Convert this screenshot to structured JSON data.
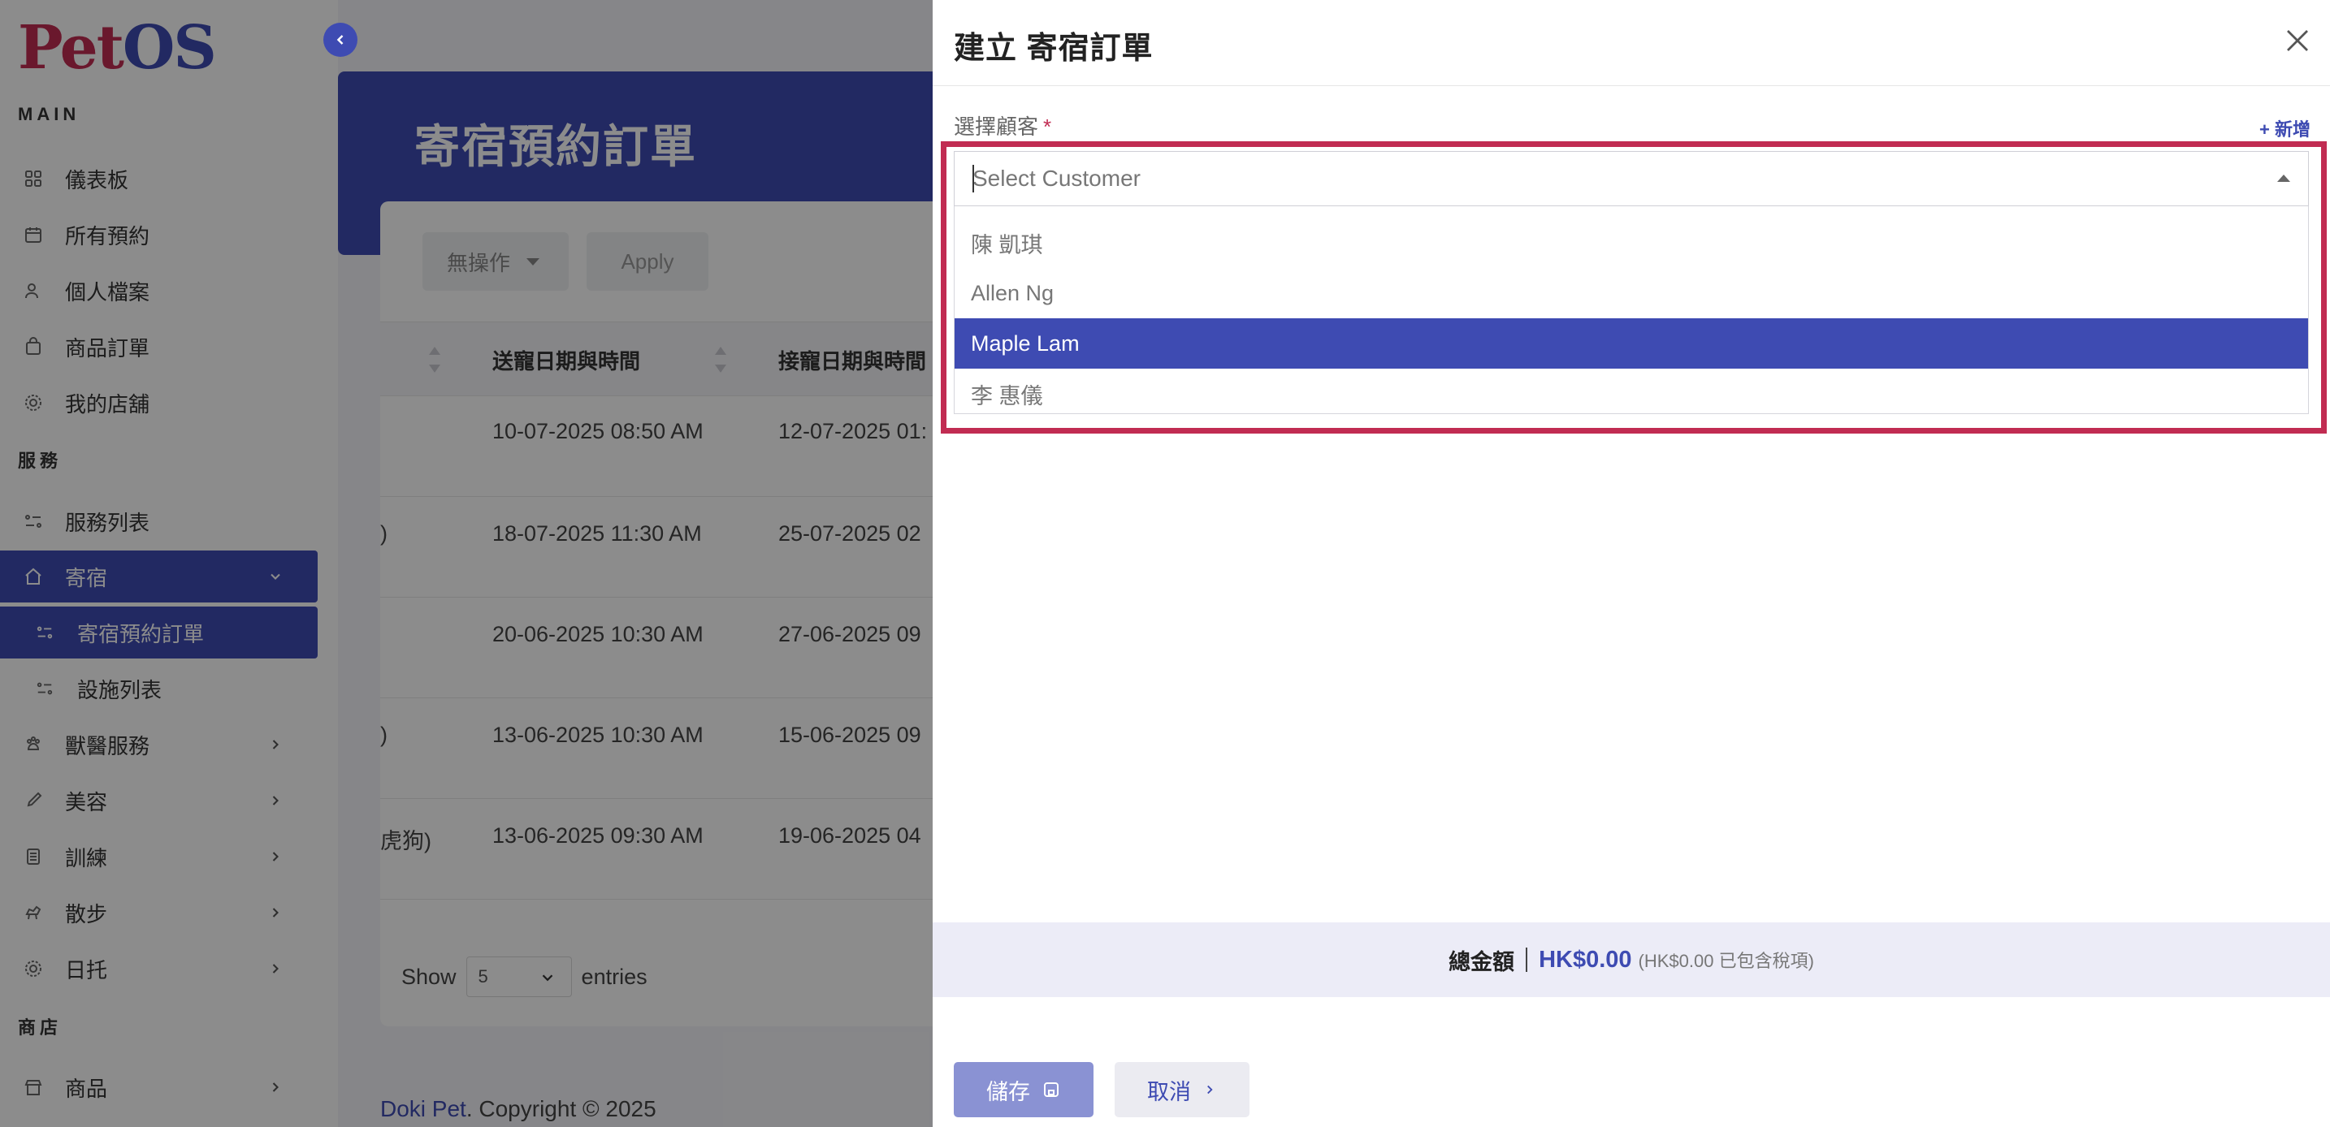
{
  "brand": {
    "logo_pet": "Pet",
    "logo_os": "OS"
  },
  "colors": {
    "primary": "#3e4bb2",
    "accent": "#c12c52",
    "overlay": "rgba(0,0,0,0.45)"
  },
  "sidebar": {
    "section_main": "MAIN",
    "section_services": "服務",
    "section_shop": "商店",
    "items": [
      {
        "label": "儀表板",
        "icon": "dashboard-grid-icon"
      },
      {
        "label": "所有預約",
        "icon": "calendar-icon"
      },
      {
        "label": "個人檔案",
        "icon": "user-icon"
      },
      {
        "label": "商品訂單",
        "icon": "bag-icon"
      },
      {
        "label": "我的店舖",
        "icon": "store-gear-icon"
      },
      {
        "label": "服務列表",
        "icon": "list-toggle-icon"
      },
      {
        "label": "寄宿",
        "icon": "home-icon",
        "expanded": true
      },
      {
        "label": "寄宿預約訂單",
        "icon": "list-toggle-icon",
        "active": true
      },
      {
        "label": "設施列表",
        "icon": "list-toggle-icon"
      },
      {
        "label": "獸醫服務",
        "icon": "vet-icon"
      },
      {
        "label": "美容",
        "icon": "brush-icon"
      },
      {
        "label": "訓練",
        "icon": "training-icon"
      },
      {
        "label": "散步",
        "icon": "dog-walk-icon"
      },
      {
        "label": "日托",
        "icon": "daycare-icon"
      },
      {
        "label": "商品",
        "icon": "shop-icon"
      }
    ]
  },
  "main": {
    "page_title": "寄宿預約訂單",
    "bulk_action": "無操作",
    "apply": "Apply",
    "columns": {
      "dropoff": "送寵日期與時間",
      "pickup": "接寵日期與時間"
    },
    "rows": [
      {
        "prefix": "",
        "dropoff": "10-07-2025 08:50 AM",
        "pickup": "12-07-2025 01:"
      },
      {
        "prefix": ")",
        "dropoff": "18-07-2025 11:30 AM",
        "pickup": "25-07-2025 02"
      },
      {
        "prefix": "",
        "dropoff": "20-06-2025 10:30 AM",
        "pickup": "27-06-2025 09"
      },
      {
        "prefix": ")",
        "dropoff": "13-06-2025 10:30 AM",
        "pickup": "15-06-2025 09"
      },
      {
        "prefix": "虎狗)",
        "dropoff": "13-06-2025 09:30 AM",
        "pickup": "19-06-2025 04"
      }
    ],
    "show": "Show",
    "entries_value": "5",
    "entries": "entries",
    "copyright_brand": "Doki Pet",
    "copyright_rest": ". Copyright © 2025"
  },
  "drawer": {
    "title": "建立 寄宿訂單",
    "customer_label": "選擇顧客",
    "required_mark": "*",
    "add_new": "新增",
    "select_placeholder": "Select Customer",
    "options": [
      {
        "label": "陳 凱琪",
        "selected": false
      },
      {
        "label": "Allen Ng",
        "selected": false
      },
      {
        "label": "Maple Lam",
        "selected": true
      },
      {
        "label": "李 惠儀",
        "selected": false
      }
    ],
    "total_label": "總金額",
    "total_amount": "HK$0.00",
    "total_tax_note": "(HK$0.00 已包含稅項)",
    "save": "儲存",
    "cancel": "取消"
  }
}
